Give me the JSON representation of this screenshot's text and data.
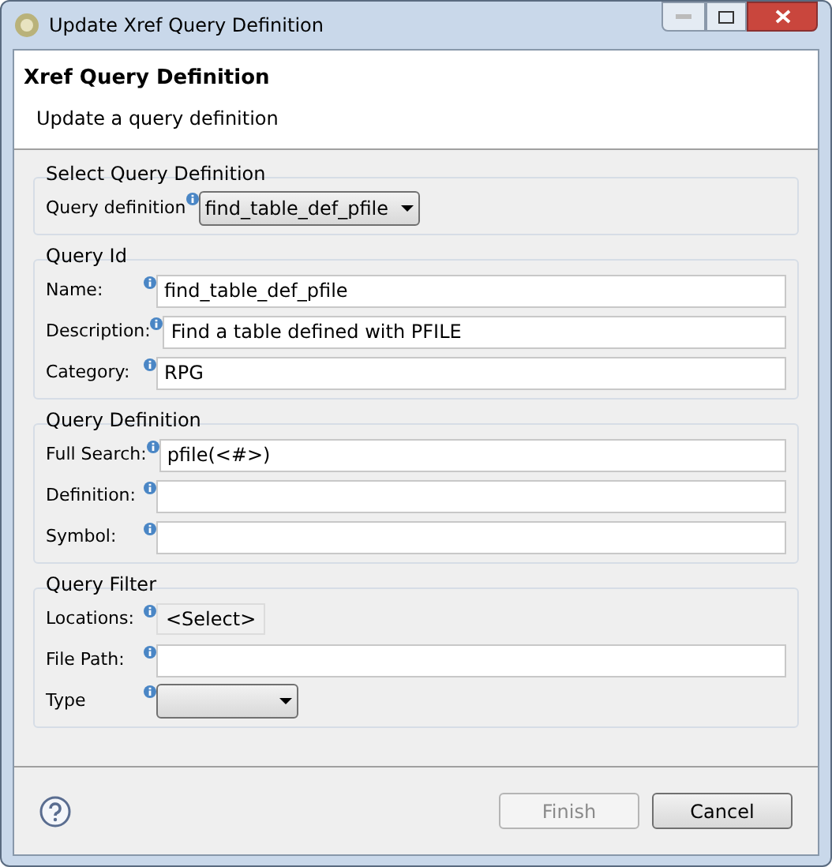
{
  "window": {
    "title": "Update Xref Query Definition"
  },
  "header": {
    "title": "Xref Query Definition",
    "message": "Update a query definition"
  },
  "groups": [
    {
      "title": "Select Query Definition",
      "fields": [
        {
          "kind": "dropdown",
          "label": "Query definition",
          "value": "find_table_def_pfile"
        }
      ]
    },
    {
      "title": "Query Id",
      "fields": [
        {
          "kind": "text",
          "label": "Name:",
          "value": "find_table_def_pfile"
        },
        {
          "kind": "text",
          "label": "Description:",
          "value": "Find a table defined with PFILE"
        },
        {
          "kind": "text",
          "label": "Category:",
          "value": "RPG"
        }
      ]
    },
    {
      "title": "Query Definition",
      "fields": [
        {
          "kind": "text",
          "label": "Full Search:",
          "value": "pfile(<#>)"
        },
        {
          "kind": "text",
          "label": "Definition:"
        },
        {
          "kind": "text",
          "label": "Symbol:"
        }
      ]
    },
    {
      "title": "Query Filter",
      "fields": [
        {
          "kind": "button",
          "label": "Locations:",
          "value": "<Select>"
        },
        {
          "kind": "text",
          "label": "File Path:"
        },
        {
          "kind": "dropdown",
          "label": "Type"
        }
      ]
    }
  ],
  "buttons": [
    {
      "label": "Finish",
      "disabled": true
    },
    {
      "label": "Cancel",
      "disabled": false
    }
  ]
}
